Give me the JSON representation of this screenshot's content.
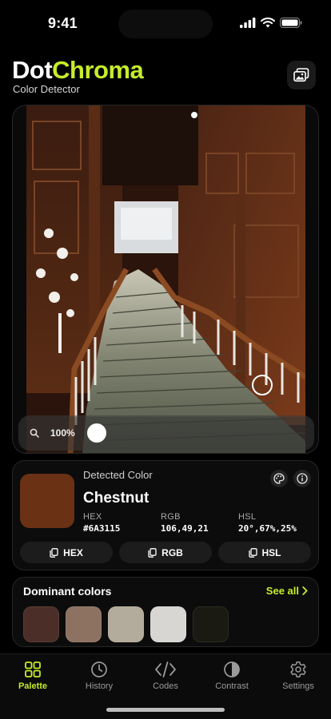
{
  "status": {
    "time": "9:41"
  },
  "header": {
    "brand_part1": "Dot",
    "brand_part2": "Chroma",
    "subtitle": "Color Detector"
  },
  "viewer": {
    "zoom": "100%"
  },
  "detected": {
    "label": "Detected Color",
    "name": "Chestnut",
    "swatch_color": "#6A3115",
    "hex_label": "HEX",
    "hex_value": "#6A3115",
    "rgb_label": "RGB",
    "rgb_value": "106,49,21",
    "hsl_label": "HSL",
    "hsl_value": "20°,67%,25%",
    "copy_buttons": [
      "HEX",
      "RGB",
      "HSL"
    ]
  },
  "dominant": {
    "title": "Dominant colors",
    "see_all": "See all",
    "swatches": [
      "#4b2e27",
      "#8d7261",
      "#b3ab9b",
      "#d7d6d2",
      "#1b1a12"
    ]
  },
  "tabs": [
    {
      "label": "Palette",
      "icon": "grid-icon",
      "active": true
    },
    {
      "label": "History",
      "icon": "clock-icon",
      "active": false
    },
    {
      "label": "Codes",
      "icon": "code-icon",
      "active": false
    },
    {
      "label": "Contrast",
      "icon": "contrast-icon",
      "active": false
    },
    {
      "label": "Settings",
      "icon": "gear-icon",
      "active": false
    }
  ],
  "colors": {
    "accent": "#c6ec2a",
    "background": "#000000"
  }
}
